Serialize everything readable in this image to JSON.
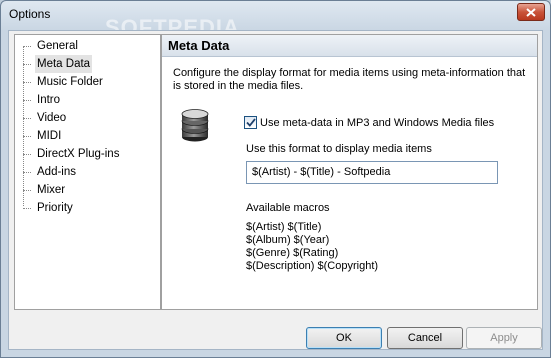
{
  "window": {
    "title": "Options",
    "watermark": "SOFTPEDIA"
  },
  "tree": {
    "items": [
      {
        "label": "General"
      },
      {
        "label": "Meta Data",
        "selected": true
      },
      {
        "label": "Music Folder"
      },
      {
        "label": "Intro"
      },
      {
        "label": "Video"
      },
      {
        "label": "MIDI"
      },
      {
        "label": "DirectX Plug-ins"
      },
      {
        "label": "Add-ins"
      },
      {
        "label": "Mixer"
      },
      {
        "label": "Priority"
      }
    ]
  },
  "panel": {
    "header": "Meta Data",
    "description": "Configure the display format for media items using meta-information that is stored in the media files.",
    "icon": "database-icon",
    "checkbox_label": "Use meta-data in MP3 and Windows Media files",
    "checkbox_checked": true,
    "format_label": "Use this format to display media items",
    "format_value": "$(Artist) - $(Title) - Softpedia",
    "macros_title": "Available macros",
    "macros": [
      "$(Artist)  $(Title)",
      "$(Album)  $(Year)",
      "$(Genre)  $(Rating)",
      "$(Description)  $(Copyright)"
    ]
  },
  "buttons": {
    "ok": "OK",
    "cancel": "Cancel",
    "apply": "Apply"
  }
}
